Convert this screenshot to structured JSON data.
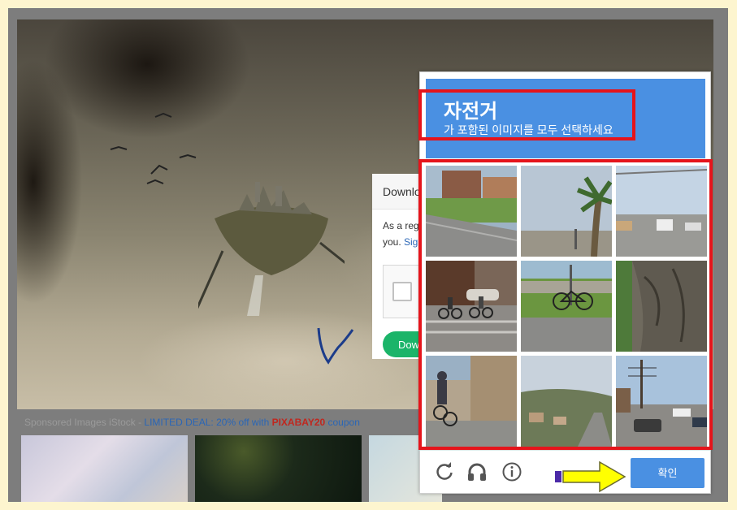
{
  "background_page": {
    "sponsored": {
      "prefix": "Sponsored Images iStock - ",
      "deal": "LIMITED DEAL: 20% off with ",
      "code": "PIXABAY20",
      "suffix": " coupon"
    },
    "download_card": {
      "title": "Downlo",
      "text_line1": "As a reg",
      "text_line2_prefix": "you. ",
      "text_line2_link": "Sig",
      "button_label": "Dow"
    }
  },
  "captcha": {
    "header": {
      "target_word": "자전거",
      "instruction": "가 포함된 이미지를 모두 선택하세요"
    },
    "tiles": [
      "street-house-tile",
      "palm-tree-tile",
      "road-trucks-tile",
      "cyclists-crosswalk-tile",
      "parked-bicycle-tile",
      "tree-trunk-tile",
      "cyclist-sidewalk-tile",
      "hillside-street-tile",
      "street-cars-tile"
    ],
    "footer": {
      "reload_icon": "reload-icon",
      "audio_icon": "headphones-icon",
      "info_icon": "info-icon",
      "verify_label": "확인"
    }
  },
  "colors": {
    "highlight": "#e5141b",
    "header_blue": "#4a90e2",
    "arrow_yellow": "#ffff00"
  }
}
